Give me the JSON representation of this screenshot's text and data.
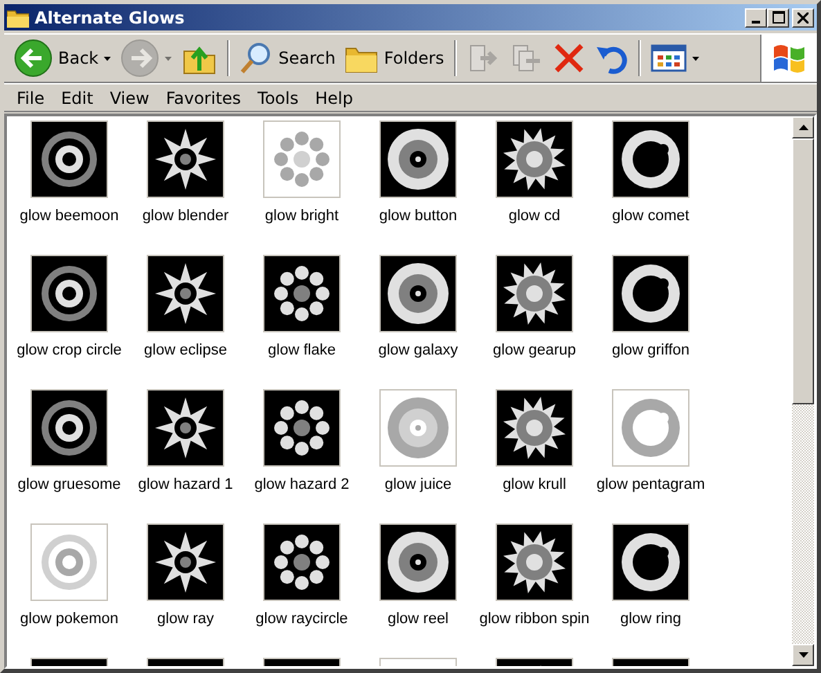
{
  "window": {
    "title": "Alternate Glows"
  },
  "toolbar": [
    {
      "kind": "back",
      "label": "Back",
      "disabled": false
    },
    {
      "kind": "forward",
      "disabled": true
    },
    {
      "kind": "up",
      "disabled": false
    },
    {
      "kind": "search",
      "label": "Search",
      "disabled": false
    },
    {
      "kind": "folders",
      "label": "Folders",
      "disabled": false
    },
    {
      "kind": "move",
      "disabled": true
    },
    {
      "kind": "copy",
      "disabled": true
    },
    {
      "kind": "delete",
      "disabled": false
    },
    {
      "kind": "undo",
      "disabled": false
    },
    {
      "kind": "views",
      "disabled": false
    }
  ],
  "menu": [
    "File",
    "Edit",
    "View",
    "Favorites",
    "Tools",
    "Help"
  ],
  "files": [
    {
      "kind": "file",
      "name": "glow beemoon"
    },
    {
      "kind": "file",
      "name": "glow blender"
    },
    {
      "kind": "file",
      "name": "glow bright"
    },
    {
      "kind": "file",
      "name": "glow button"
    },
    {
      "kind": "file",
      "name": "glow cd"
    },
    {
      "kind": "file",
      "name": "glow comet"
    },
    {
      "kind": "file",
      "name": "glow crop circle"
    },
    {
      "kind": "file",
      "name": "glow eclipse"
    },
    {
      "kind": "file",
      "name": "glow flake"
    },
    {
      "kind": "file",
      "name": "glow galaxy"
    },
    {
      "kind": "file",
      "name": "glow gearup"
    },
    {
      "kind": "file",
      "name": "glow griffon"
    },
    {
      "kind": "file",
      "name": "glow gruesome"
    },
    {
      "kind": "file",
      "name": "glow hazard 1"
    },
    {
      "kind": "file",
      "name": "glow hazard 2"
    },
    {
      "kind": "file",
      "name": "glow juice"
    },
    {
      "kind": "file",
      "name": "glow krull"
    },
    {
      "kind": "file",
      "name": "glow pentagram"
    },
    {
      "kind": "file",
      "name": "glow pokemon"
    },
    {
      "kind": "file",
      "name": "glow ray"
    },
    {
      "kind": "file",
      "name": "glow raycircle"
    },
    {
      "kind": "file",
      "name": "glow reel"
    },
    {
      "kind": "file",
      "name": "glow ribbon spin"
    },
    {
      "kind": "file",
      "name": "glow ring"
    },
    {
      "kind": "cut"
    },
    {
      "kind": "cut"
    },
    {
      "kind": "cut"
    },
    {
      "kind": "cut"
    },
    {
      "kind": "cut"
    },
    {
      "kind": "cut"
    }
  ]
}
